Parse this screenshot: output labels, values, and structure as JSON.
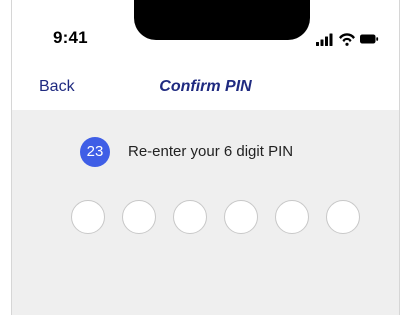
{
  "status_bar": {
    "time": "9:41",
    "icons": [
      "cellular-signal-icon",
      "wifi-icon",
      "battery-icon"
    ]
  },
  "nav": {
    "back_label": "Back",
    "title": "Confirm PIN"
  },
  "step": {
    "number": "23",
    "instruction": "Re-enter your 6 digit PIN"
  },
  "pin": {
    "length": 6,
    "entered": 0
  },
  "colors": {
    "accent": "#3f5ee6",
    "nav_text": "#1f2a80",
    "content_background": "#efefef"
  }
}
